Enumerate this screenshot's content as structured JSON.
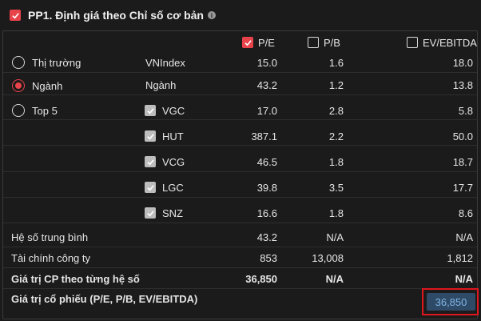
{
  "header": {
    "title": "PP1. Định giá theo Chỉ số cơ bản",
    "info_icon": "info-icon"
  },
  "columns": [
    {
      "label": "P/E",
      "checked": true
    },
    {
      "label": "P/B",
      "checked": false
    },
    {
      "label": "EV/EBITDA",
      "checked": false
    }
  ],
  "groups": [
    {
      "label": "Thị trường",
      "selected": false,
      "code": "VNIndex",
      "pe": "15.0",
      "pb": "1.6",
      "ev": "18.0"
    },
    {
      "label": "Ngành",
      "selected": true,
      "code": "Ngành",
      "pe": "43.2",
      "pb": "1.2",
      "ev": "13.8"
    },
    {
      "label": "Top 5",
      "selected": false
    }
  ],
  "peers": [
    {
      "code": "VGC",
      "pe": "17.0",
      "pb": "2.8",
      "ev": "5.8"
    },
    {
      "code": "HUT",
      "pe": "387.1",
      "pb": "2.2",
      "ev": "50.0"
    },
    {
      "code": "VCG",
      "pe": "46.5",
      "pb": "1.8",
      "ev": "18.7"
    },
    {
      "code": "LGC",
      "pe": "39.8",
      "pb": "3.5",
      "ev": "17.7"
    },
    {
      "code": "SNZ",
      "pe": "16.6",
      "pb": "1.8",
      "ev": "8.6"
    }
  ],
  "summary": [
    {
      "label": "Hệ số trung bình",
      "pe": "43.2",
      "pb": "N/A",
      "ev": "N/A"
    },
    {
      "label": "Tài chính công ty",
      "pe": "853",
      "pb": "13,008",
      "ev": "1,812"
    },
    {
      "label": "Giá trị CP theo từng hệ số",
      "pe": "36,850",
      "pb": "N/A",
      "ev": "N/A"
    }
  ],
  "final": {
    "label": "Giá trị cổ phiếu (P/E, P/B, EV/EBITDA)",
    "value": "36,850"
  },
  "colors": {
    "accent": "#e8424a",
    "final_bg": "#2f4a66",
    "final_text": "#7fb4e4",
    "highlight_border": "#e0161f"
  }
}
